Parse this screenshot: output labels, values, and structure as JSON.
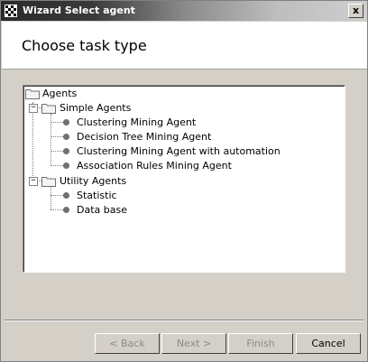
{
  "window": {
    "title": "Wizard Select agent",
    "close_label": "x"
  },
  "header": {
    "title": "Choose task type"
  },
  "tree": {
    "root": "Agents",
    "groups": [
      {
        "label": "Simple Agents",
        "items": [
          "Clustering Mining Agent",
          "Decision Tree Mining Agent",
          "Clustering Mining Agent with automation",
          "Association Rules Mining Agent"
        ]
      },
      {
        "label": "Utility Agents",
        "items": [
          "Statistic",
          "Data base"
        ]
      }
    ],
    "collapse_symbol": "−"
  },
  "buttons": {
    "back": "< Back",
    "next": "Next >",
    "finish": "Finish",
    "cancel": "Cancel"
  }
}
